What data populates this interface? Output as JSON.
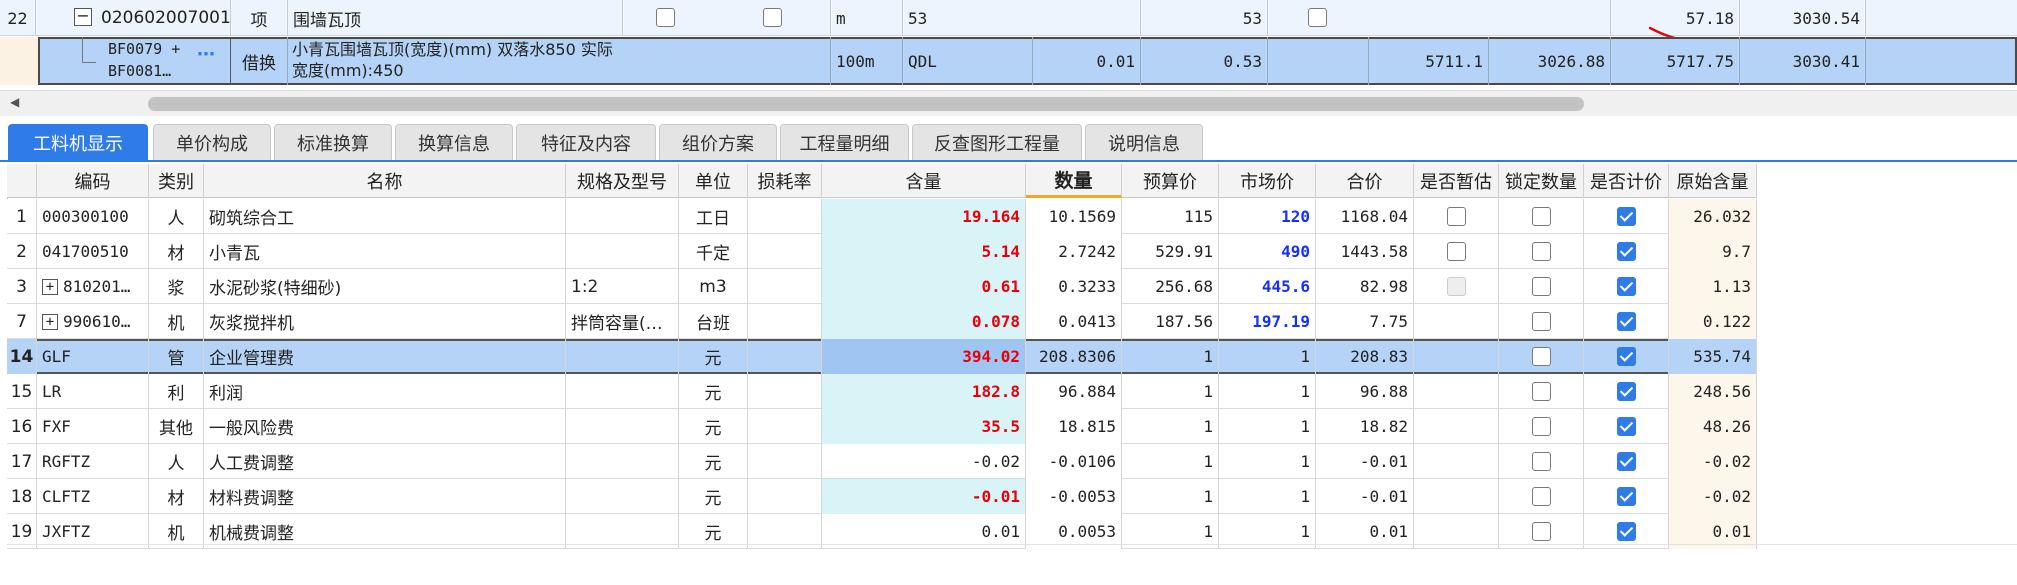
{
  "top_rows": [
    {
      "no": "22",
      "code": "020602007001",
      "type": "项",
      "name": "围墙瓦顶",
      "unit": "m",
      "expr": "53",
      "qty": "53",
      "v_mid": "57.18",
      "v_last": "3030.54"
    },
    {
      "code": "BF0079 + BF0081…",
      "type": "借换",
      "name": "小青瓦围墙瓦顶(宽度)(mm) 双落水850 实际宽度(mm):450",
      "unit": "100m",
      "expr": "QDL",
      "expr_val": "0.01",
      "qty": "0.53",
      "v1": "5711.1",
      "v2": "3026.88",
      "v3": "5717.75",
      "v4": "3030.41"
    }
  ],
  "tabs": [
    "工料机显示",
    "单价构成",
    "标准换算",
    "换算信息",
    "特征及内容",
    "组价方案",
    "工程量明细",
    "反查图形工程量",
    "说明信息"
  ],
  "columns": [
    "编码",
    "类别",
    "名称",
    "规格及型号",
    "单位",
    "损耗率",
    "含量",
    "数量",
    "预算价",
    "市场价",
    "合价",
    "是否暂估",
    "锁定数量",
    "是否计价",
    "原始含量"
  ],
  "rows": [
    {
      "no": "1",
      "code": "000300100",
      "cat": "人",
      "name": "砌筑综合工",
      "spec": "",
      "unit": "工日",
      "loss": "",
      "content": "19.164",
      "qty": "10.1569",
      "budget": "115",
      "market": "120",
      "total": "1168.04",
      "est": false,
      "lock": false,
      "price": true,
      "orig": "26.032",
      "expand": false,
      "content_color": "red",
      "market_color": "blue"
    },
    {
      "no": "2",
      "code": "041700510",
      "cat": "材",
      "name": "小青瓦",
      "spec": "",
      "unit": "千定",
      "loss": "",
      "content": "5.14",
      "qty": "2.7242",
      "budget": "529.91",
      "market": "490",
      "total": "1443.58",
      "est": false,
      "lock": false,
      "price": true,
      "orig": "9.7",
      "expand": false,
      "content_color": "red",
      "market_color": "blue"
    },
    {
      "no": "3",
      "code": "810201…",
      "cat": "浆",
      "name": "水泥砂浆(特细砂)",
      "spec": "1:2",
      "unit": "m3",
      "loss": "",
      "content": "0.61",
      "qty": "0.3233",
      "budget": "256.68",
      "market": "445.6",
      "total": "82.98",
      "est": "dis",
      "lock": false,
      "price": true,
      "orig": "1.13",
      "expand": true,
      "content_color": "red",
      "market_color": "blue"
    },
    {
      "no": "7",
      "code": "990610…",
      "cat": "机",
      "name": "灰浆搅拌机",
      "spec": "拌筒容量(…",
      "unit": "台班",
      "loss": "",
      "content": "0.078",
      "qty": "0.0413",
      "budget": "187.56",
      "market": "197.19",
      "total": "7.75",
      "est": null,
      "lock": false,
      "price": true,
      "orig": "0.122",
      "expand": true,
      "content_color": "red",
      "market_color": "blue"
    },
    {
      "no": "14",
      "code": "GLF",
      "cat": "管",
      "name": "企业管理费",
      "spec": "",
      "unit": "元",
      "loss": "",
      "content": "394.02",
      "qty": "208.8306",
      "budget": "1",
      "market": "1",
      "total": "208.83",
      "est": null,
      "lock": false,
      "price": true,
      "orig": "535.74",
      "expand": false,
      "content_color": "red",
      "market_color": "",
      "selected": true
    },
    {
      "no": "15",
      "code": "LR",
      "cat": "利",
      "name": "利润",
      "spec": "",
      "unit": "元",
      "loss": "",
      "content": "182.8",
      "qty": "96.884",
      "budget": "1",
      "market": "1",
      "total": "96.88",
      "est": null,
      "lock": false,
      "price": true,
      "orig": "248.56",
      "expand": false,
      "content_color": "red",
      "market_color": ""
    },
    {
      "no": "16",
      "code": "FXF",
      "cat": "其他",
      "name": "一般风险费",
      "spec": "",
      "unit": "元",
      "loss": "",
      "content": "35.5",
      "qty": "18.815",
      "budget": "1",
      "market": "1",
      "total": "18.82",
      "est": null,
      "lock": false,
      "price": true,
      "orig": "48.26",
      "expand": false,
      "content_color": "red",
      "market_color": ""
    },
    {
      "no": "17",
      "code": "RGFTZ",
      "cat": "人",
      "name": "人工费调整",
      "spec": "",
      "unit": "元",
      "loss": "",
      "content": "-0.02",
      "qty": "-0.0106",
      "budget": "1",
      "market": "1",
      "total": "-0.01",
      "est": null,
      "lock": false,
      "price": true,
      "orig": "-0.02",
      "expand": false,
      "content_color": "",
      "market_color": "",
      "content_plain": true
    },
    {
      "no": "18",
      "code": "CLFTZ",
      "cat": "材",
      "name": "材料费调整",
      "spec": "",
      "unit": "元",
      "loss": "",
      "content": "-0.01",
      "qty": "-0.0053",
      "budget": "1",
      "market": "1",
      "total": "-0.01",
      "est": null,
      "lock": false,
      "price": true,
      "orig": "-0.02",
      "expand": false,
      "content_color": "red",
      "market_color": ""
    },
    {
      "no": "19",
      "code": "JXFTZ",
      "cat": "机",
      "name": "机械费调整",
      "spec": "",
      "unit": "元",
      "loss": "",
      "content": "0.01",
      "qty": "0.0053",
      "budget": "1",
      "market": "1",
      "total": "0.01",
      "est": null,
      "lock": false,
      "price": true,
      "orig": "0.01",
      "expand": false,
      "content_color": "",
      "market_color": "",
      "content_plain": true
    }
  ],
  "colors": {
    "accent": "#2f7ce8",
    "selected_row": "#b4d3f7",
    "content_bg": "#d9f4f6",
    "orig_bg": "#fdf6ea",
    "annotation": "#e8000c"
  }
}
